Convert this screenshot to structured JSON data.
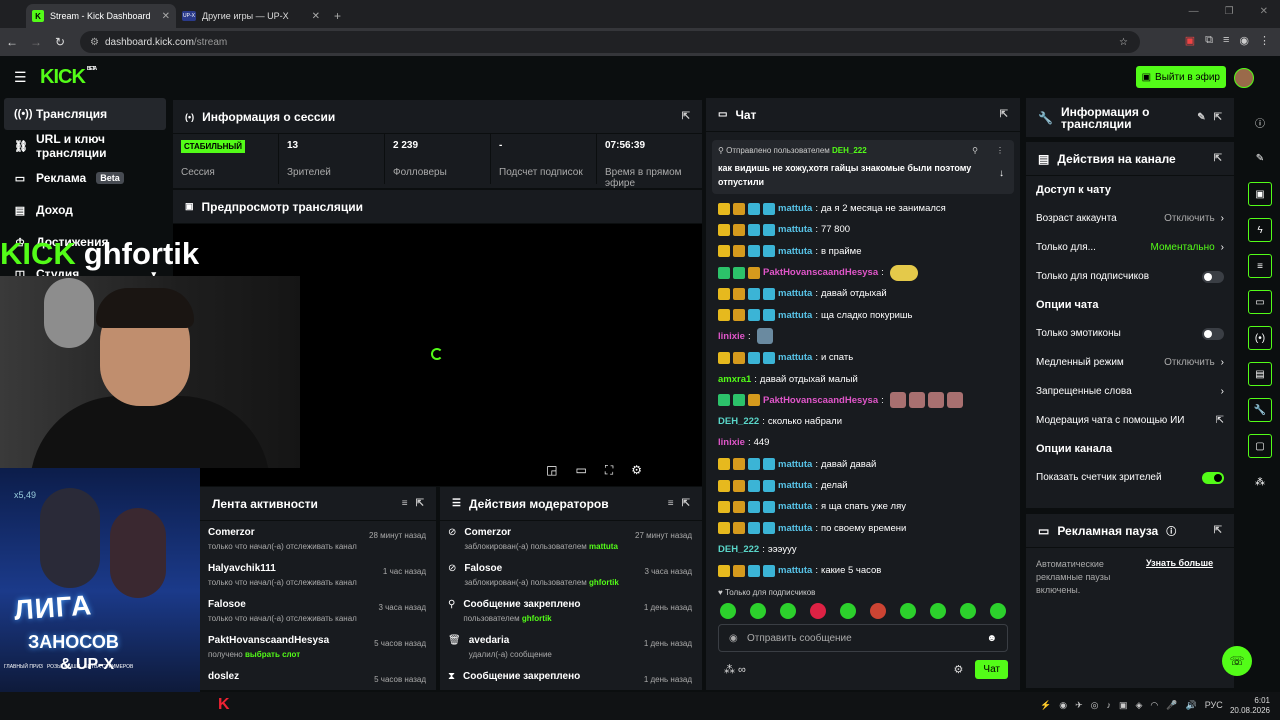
{
  "browser": {
    "tabs": [
      {
        "title": "Stream - Kick Dashboard",
        "favicon": "K"
      },
      {
        "title": "Другие игры — UP-X",
        "favicon": "UP-X"
      }
    ],
    "new_tab": "+",
    "url_host": "dashboard.kick.com",
    "url_path": "/stream"
  },
  "topbar": {
    "logo": "KICK",
    "logo_badge": "BETA",
    "go_live": "Выйти в эфир"
  },
  "sidebar": {
    "items": [
      {
        "label": "Трансляция",
        "icon": "broadcast-icon"
      },
      {
        "label": "URL и ключ трансляции",
        "icon": "link-icon"
      },
      {
        "label": "Реклама",
        "icon": "ad-icon",
        "badge": "Beta"
      },
      {
        "label": "Доход",
        "icon": "chart-icon"
      },
      {
        "label": "Достижения",
        "icon": "trophy-icon"
      },
      {
        "label": "Студия",
        "icon": "studio-icon"
      }
    ]
  },
  "overlay": {
    "kick": "KICK",
    "name": "ghfortik"
  },
  "session": {
    "title": "Информация о сессии",
    "stats": [
      {
        "value": "СТАБИЛЬНЫЙ",
        "label": "Сессия"
      },
      {
        "value": "13",
        "label": "Зрителей"
      },
      {
        "value": "2 239",
        "label": "Фолловеры"
      },
      {
        "value": "-",
        "label": "Подсчет подписок"
      },
      {
        "value": "07:56:39",
        "label": "Время в прямом эфире"
      }
    ]
  },
  "preview": {
    "title": "Предпросмотр трансляции"
  },
  "activity": {
    "title": "Лента активности",
    "items": [
      {
        "name": "Comerzor",
        "text": "только что начал(-а) отслеживать канал",
        "ago": "28 минут назад"
      },
      {
        "name": "Halyavchik111",
        "text": "только что начал(-а) отслеживать канал",
        "ago": "1 час назад"
      },
      {
        "name": "Falosoe",
        "text": "только что начал(-а) отслеживать канал",
        "ago": "3 часа назад"
      },
      {
        "name": "PaktHovanscaandHesysa",
        "text": "получено",
        "hl": "выбрать слот",
        "ago": "5 часов назад"
      },
      {
        "name": "doslez",
        "text": "",
        "ago": "5 часов назад"
      }
    ]
  },
  "modactions": {
    "title": "Действия модераторов",
    "items": [
      {
        "icon": "ban-icon",
        "name": "Comerzor",
        "text": "заблокирован(-а) пользователем",
        "hl": "mattuta",
        "ago": "27 минут назад"
      },
      {
        "icon": "ban-icon",
        "name": "Falosoe",
        "text": "заблокирован(-а) пользователем",
        "hl": "ghfortik",
        "ago": "3 часа назад"
      },
      {
        "icon": "pin-icon",
        "name": "Сообщение закреплено",
        "text": "пользователем",
        "hl": "ghfortik",
        "ago": "1 день назад"
      },
      {
        "icon": "trash-icon",
        "name": "avedaria",
        "text": "удалил(-а) сообщение",
        "hl": "",
        "ago": "1 день назад"
      },
      {
        "icon": "hourglass-icon",
        "name": "Сообщение закреплено",
        "text": "",
        "hl": "",
        "ago": "1 день назад"
      }
    ]
  },
  "chat": {
    "title": "Чат",
    "pinned_label": "Отправлено пользователем",
    "pinned_user": "DEH_222",
    "pinned_text": "как видишь не хожу,хотя гайцы знакомые были поэтому отпустили",
    "messages": [
      {
        "badges": "yoti",
        "user": "mattuta",
        "color": "cy",
        "text": "да я 2 месяца не занимался"
      },
      {
        "badges": "yoti",
        "user": "mattuta",
        "color": "cy",
        "text": "77 800"
      },
      {
        "badges": "yoti",
        "user": "mattuta",
        "color": "cy",
        "text": "в прайме"
      },
      {
        "badges": "ggo",
        "user": "PaktHovanscaandHesysa",
        "color": "pk",
        "text": "",
        "emote": "1"
      },
      {
        "badges": "yoti",
        "user": "mattuta",
        "color": "cy",
        "text": "давай отдыхай"
      },
      {
        "badges": "yoti",
        "user": "mattuta",
        "color": "cy",
        "text": "ща сладко покуришь"
      },
      {
        "badges": "",
        "user": "linixie",
        "color": "pk",
        "text": "",
        "emote": "s"
      },
      {
        "badges": "yoti",
        "user": "mattuta",
        "color": "cy",
        "text": "и спать"
      },
      {
        "badges": "",
        "user": "amxra1",
        "color": "gr",
        "text": "давай отдыхай малый"
      },
      {
        "badges": "ggo",
        "user": "PaktHovanscaandHesysa",
        "color": "pk",
        "text": "",
        "emote": "4"
      },
      {
        "badges": "",
        "user": "DEH_222",
        "color": "tq",
        "text": "сколько набрали"
      },
      {
        "badges": "",
        "user": "linixie",
        "color": "pk",
        "text": "449"
      },
      {
        "badges": "yoti",
        "user": "mattuta",
        "color": "cy",
        "text": "давай давай"
      },
      {
        "badges": "yoti",
        "user": "mattuta",
        "color": "cy",
        "text": "делай"
      },
      {
        "badges": "yoti",
        "user": "mattuta",
        "color": "cy",
        "text": "я ща спать уже ляу"
      },
      {
        "badges": "yoti",
        "user": "mattuta",
        "color": "cy",
        "text": "по своему времени"
      },
      {
        "badges": "",
        "user": "DEH_222",
        "color": "tq",
        "text": "эээууу"
      },
      {
        "badges": "yoti",
        "user": "mattuta",
        "color": "cy",
        "text": "какие 5 часов"
      }
    ],
    "sub_only": "Только для подписчиков",
    "placeholder": "Отправить сообщение",
    "send": "Чат"
  },
  "right": {
    "stream_info": "Информация о трансляции",
    "channel_actions": "Действия на канале",
    "chat_access": "Доступ к чату",
    "account_age": "Возраст аккаунта",
    "account_age_val": "Отключить",
    "only_for": "Только для...",
    "only_for_val": "Моментально",
    "subs_only": "Только для подписчиков",
    "chat_options": "Опции чата",
    "emotes_only": "Только эмотиконы",
    "slow_mode": "Медленный режим",
    "slow_mode_val": "Отключить",
    "banned_words": "Запрещенные слова",
    "ai_mod": "Модерация чата с помощью ИИ",
    "channel_options": "Опции канала",
    "show_viewers": "Показать счетчик зрителей",
    "ad_break": "Рекламная пауза",
    "ad_text": "Автоматические рекламные паузы включены.",
    "learn_more": "Узнать больше"
  },
  "promo": {
    "x": "x5,49",
    "line1": "ЛИГА",
    "line2": "ЗАНОСОВ",
    "line3": "& UP-X",
    "tags": [
      "ГЛАВНЫЙ ПРИЗ",
      "РОЗЫГРЫШИ",
      "БИТВА СТРИМЕРОВ"
    ]
  },
  "taskbar": {
    "lang": "РУС",
    "time": "6:01",
    "date": "20.08.2026"
  }
}
